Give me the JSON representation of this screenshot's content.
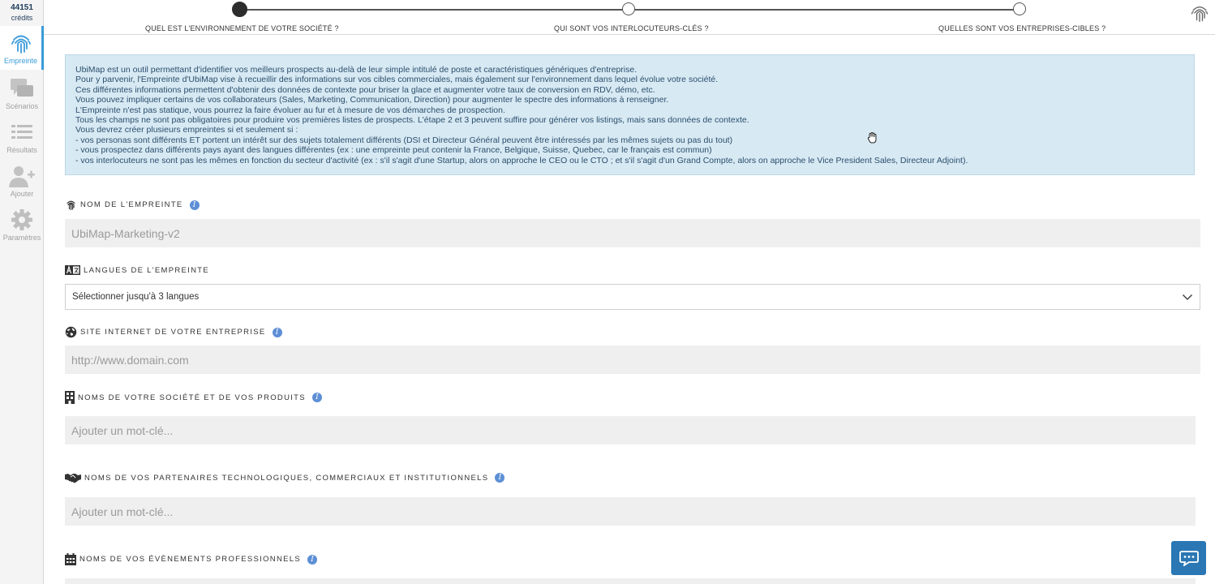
{
  "sidebar": {
    "credits_value": "44151",
    "credits_label": "crédits",
    "items": [
      {
        "label": "Empreinte",
        "icon": "fingerprint-icon"
      },
      {
        "label": "Scénarios",
        "icon": "chat-bubbles-icon"
      },
      {
        "label": "Résultats",
        "icon": "list-icon"
      },
      {
        "label": "Ajouter",
        "icon": "add-user-icon"
      },
      {
        "label": "Paramètres",
        "icon": "gear-icon"
      }
    ]
  },
  "steps": [
    {
      "label": "QUEL EST L'ENVIRONNEMENT DE VOTRE SOCIÉTÉ ?",
      "state": "active"
    },
    {
      "label": "QUI SONT VOS INTERLOCUTEURS-CLÉS ?",
      "state": "pending"
    },
    {
      "label": "QUELLES SONT VOS ENTREPRISES-CIBLES ?",
      "state": "pending"
    }
  ],
  "info_lines": [
    "UbiMap est un outil permettant d'identifier vos meilleurs prospects au-delà de leur simple intitulé de poste et caractéristiques génériques d'entreprise.",
    "Pour y parvenir, l'Empreinte d'UbiMap vise à recueillir des informations sur vos cibles commerciales, mais également sur l'environnement dans lequel évolue votre société.",
    "Ces différentes informations permettent d'obtenir des données de contexte pour briser la glace et augmenter votre taux de conversion en RDV, démo, etc.",
    "Vous pouvez impliquer certains de vos collaborateurs (Sales, Marketing, Communication, Direction) pour augmenter le spectre des informations à renseigner.",
    "L'Empreinte n'est pas statique, vous pourrez la faire évoluer au fur et à mesure de vos démarches de prospection.",
    "Tous les champs ne sont pas obligatoires pour produire vos premières listes de prospects. L'étape 2 et 3 peuvent suffire pour générer vos listings, mais sans données de contexte.",
    "Vous devrez créer plusieurs empreintes si et seulement si :",
    "- vos personas sont différents ET portent un intérêt sur des sujets totalement différents (DSI et Directeur Général peuvent être intéressés par les mêmes sujets ou pas du tout)",
    "- vous prospectez dans différents pays ayant des langues différentes (ex : une empreinte peut contenir la France, Belgique, Suisse, Quebec, car le français est commun)",
    "- vos interlocuteurs ne sont pas les mêmes en fonction du secteur d'activité (ex : s'il s'agit d'une Startup, alors on approche le CEO ou le CTO ; et s'il s'agit d'un Grand Compte, alors on approche le Vice President Sales, Directeur Adjoint)."
  ],
  "fields": {
    "name": {
      "label": "Nom de l'empreinte",
      "value": "UbiMap-Marketing-v2",
      "icon": "fingerprint-icon"
    },
    "languages": {
      "label": "Langues de l'empreinte",
      "value": "Sélectionner jusqu'à 3 langues",
      "icon": "language-icon"
    },
    "website": {
      "label": "Site internet de votre entreprise",
      "placeholder": "http://www.domain.com",
      "icon": "globe-icon"
    },
    "company": {
      "label": "Noms de votre société et de vos produits",
      "placeholder": "Ajouter un mot-clé...",
      "icon": "building-icon"
    },
    "partners": {
      "label": "Noms de vos partenaires technologiques, commerciaux et institutionnels",
      "placeholder": "Ajouter un mot-clé...",
      "icon": "handshake-icon"
    },
    "events": {
      "label": "Noms de vos évènements professionnels",
      "icon": "calendar-icon"
    }
  },
  "info_icon_glyph": "i",
  "colors": {
    "accent": "#3a9bd9",
    "info_bg": "#d7e9f3",
    "chat_button": "#2a77b4"
  }
}
